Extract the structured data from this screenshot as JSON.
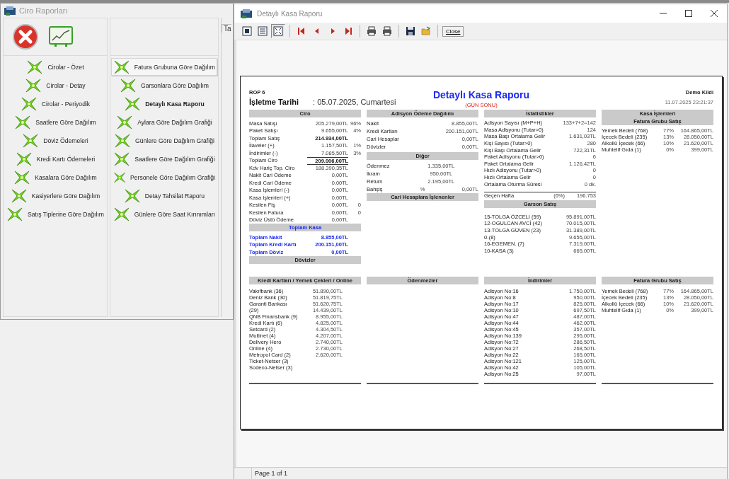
{
  "left_window": {
    "title": "Ciro Raporları",
    "hidden_tab": "Ta",
    "column_1": [
      {
        "label": "Cirolar - Özet",
        "selected": false,
        "hovered": false
      },
      {
        "label": "Cirolar - Detay",
        "selected": false,
        "hovered": false
      },
      {
        "label": "Cirolar - Periyodik",
        "selected": false,
        "hovered": false
      },
      {
        "label": "Saatlere Göre Dağılım",
        "selected": false,
        "hovered": false
      },
      {
        "label": "Döviz Ödemeleri",
        "selected": false,
        "hovered": false
      },
      {
        "label": "Kredi Kartı Ödemeleri",
        "selected": false,
        "hovered": false
      },
      {
        "label": "Kasalara Göre Dağılım",
        "selected": false,
        "hovered": false
      },
      {
        "label": "Kasiyerlere Göre Dağılım",
        "selected": false,
        "hovered": false
      },
      {
        "label": "Satış Tiplerine Göre Dağılım",
        "selected": false,
        "hovered": false
      }
    ],
    "column_2": [
      {
        "label": "Fatura Grubuna Göre Dağılım",
        "selected": false,
        "hovered": true
      },
      {
        "label": "Garsonlara Göre Dağılım",
        "selected": false,
        "hovered": false
      },
      {
        "label": "Detaylı Kasa Raporu",
        "selected": true,
        "hovered": false
      },
      {
        "label": "Aylara Göre Dağılım Grafiği",
        "selected": false,
        "hovered": false
      },
      {
        "label": "Günlere Göre Dağılım Grafiği",
        "selected": false,
        "hovered": false
      },
      {
        "label": "Saatlere Göre Dağılım Grafiği",
        "selected": false,
        "hovered": false
      },
      {
        "label": "Personele Göre Dağılım Grafiği",
        "selected": false,
        "hovered": false
      },
      {
        "label": "Detay Tahsilat Raporu",
        "selected": false,
        "hovered": false
      },
      {
        "label": "Günlere Göre Saat Kırınımları",
        "selected": false,
        "hovered": false
      }
    ]
  },
  "report_window": {
    "title": "Detaylı Kasa Raporu",
    "view_modes": [
      {
        "selected": false
      },
      {
        "selected": false
      },
      {
        "selected": true
      }
    ],
    "close_button": "Close",
    "status": "Page 1 of 1",
    "report": {
      "code": "ROP 6",
      "date_label": "İşletme Tarihi",
      "date_value": ": 05.07.2025, Cumartesi",
      "title": "Detaylı Kasa Raporu",
      "subtitle": "(GÜN SONU)",
      "company": "Demo Kildi",
      "printed_at": "11.07.2025 23:21:37",
      "top_columns": [
        [
          {
            "title": "Ciro",
            "kind": "ciro",
            "rows": [
              {
                "kind": "plain",
                "cells": [
                  "Masa Satışı",
                  "205.279,00TL",
                  "96%"
                ]
              },
              {
                "kind": "plain",
                "cells": [
                  "Paket Satışı",
                  "9.655,00TL",
                  "4%"
                ]
              },
              {
                "kind": "bold",
                "cells": [
                  "Toplam Satış",
                  "214.934,00TL"
                ]
              },
              {
                "kind": "plain",
                "cells": [
                  "İlaveler (+)",
                  "1.157,50TL",
                  "1%"
                ]
              },
              {
                "kind": "plain",
                "cells": [
                  "İndirimler (-)",
                  "7.085,50TL",
                  "3%"
                ]
              },
              {
                "kind": "ruled-bold",
                "cells": [
                  "Toplam Ciro",
                  "209.006,00TL"
                ]
              },
              {
                "kind": "ruled",
                "cells": [
                  "Kdv Hariç Top. Ciro",
                  "188.390,35TL"
                ]
              },
              {
                "kind": "plain",
                "cells": [
                  "Nakit Cari Ödeme",
                  "0,00TL"
                ]
              },
              {
                "kind": "plain",
                "cells": [
                  "Kredi Cari Ödeme",
                  "0,00TL"
                ]
              },
              {
                "kind": "plain",
                "cells": [
                  "Kasa İşlemleri (-)",
                  "0,00TL"
                ]
              },
              {
                "kind": "plain",
                "cells": [
                  "Kasa İşlemleri (+)",
                  "0,00TL"
                ]
              },
              {
                "kind": "plain",
                "cells": [
                  "Kesilen Fiş",
                  "0,00TL",
                  "0"
                ]
              },
              {
                "kind": "plain",
                "cells": [
                  "Kesilen Fatura",
                  "0,00TL",
                  "0"
                ]
              },
              {
                "kind": "plain",
                "cells": [
                  "Döviz Üstü Ödeme",
                  "0,00TL"
                ]
              }
            ]
          },
          {
            "title": "Toplam Kasa",
            "kind": "totals",
            "rows": [
              {
                "kind": "bold",
                "cells": [
                  "Toplam Nakit",
                  "8.855,00TL"
                ]
              },
              {
                "kind": "bold",
                "cells": [
                  "Toplam Kredi Kartı",
                  "200.151,00TL"
                ]
              },
              {
                "kind": "bold",
                "cells": [
                  "Toplam Döviz",
                  "0,00TL"
                ]
              }
            ]
          },
          {
            "title": "Dövizler",
            "kind": "empty"
          }
        ],
        [
          {
            "title": "Adisyon Ödeme Dağılımı",
            "kind": "payment",
            "rows": [
              {
                "kind": "plain",
                "cells": [
                  "Nakit",
                  "8.855,00TL"
                ]
              },
              {
                "kind": "plain",
                "cells": [
                  "Kredi Kartları",
                  "200.151,00TL"
                ]
              },
              {
                "kind": "plain",
                "cells": [
                  "Cari Hesaplar",
                  "0,00TL"
                ]
              },
              {
                "kind": "plain",
                "cells": [
                  "Dövizler",
                  "0,00TL"
                ]
              }
            ]
          },
          {
            "title": "Diğer",
            "kind": "other",
            "rows": [
              {
                "kind": "plain",
                "cells": [
                  "Ödenmez",
                  "1.335,00TL"
                ]
              },
              {
                "kind": "plain",
                "cells": [
                  "İkram",
                  "950,00TL"
                ]
              },
              {
                "kind": "plain",
                "cells": [
                  "Return",
                  "2.195,00TL"
                ]
              },
              {
                "kind": "plain",
                "cells": [
                  "Bahşiş",
                  "%",
                  "0,00TL"
                ]
              }
            ]
          },
          {
            "title": "Cari Hesaplara İşlenenler",
            "kind": "empty"
          }
        ],
        [
          {
            "title": "İstatistikler",
            "kind": "stats",
            "rows": [
              {
                "kind": "plain",
                "cells": [
                  "Adisyon Sayısı (M+P+H)",
                  "133+7+2=142"
                ]
              },
              {
                "kind": "plain",
                "cells": [
                  "Masa Adisyonu (Tutar>0)",
                  "124"
                ]
              },
              {
                "kind": "plain",
                "cells": [
                  "Masa Başı Ortalama Gelir",
                  "1.631,03TL"
                ]
              },
              {
                "kind": "plain",
                "cells": [
                  "Kişi Sayısı (Tutar>0)",
                  "280"
                ]
              },
              {
                "kind": "plain",
                "cells": [
                  "Kişi Başı Ortalama Gelir",
                  "722,31TL"
                ]
              },
              {
                "kind": "plain",
                "cells": [
                  "Paket Adisyonu (Tutar>0)",
                  "6"
                ]
              },
              {
                "kind": "plain",
                "cells": [
                  "Paket Ortalama Gelir",
                  "1.126,42TL"
                ]
              },
              {
                "kind": "plain",
                "cells": [
                  "Hızlı Adisyonu (Tutar>0)",
                  "0"
                ]
              },
              {
                "kind": "plain",
                "cells": [
                  "Hızlı Ortalama Gelir",
                  "0"
                ]
              },
              {
                "kind": "plain",
                "cells": [
                  "Ortalama Oturma Süresi",
                  "0 dk."
                ]
              },
              {
                "kind": "ruled",
                "cells": [
                  "Geçen Hafta",
                  "(6%)",
                  "196.753"
                ]
              }
            ]
          },
          {
            "title": "Garson Satış",
            "kind": "waiter",
            "rows": [
              {
                "kind": "plain",
                "cells": [
                  "15-TOLGA ÖZCELİ (59)",
                  "95.891,00TL"
                ]
              },
              {
                "kind": "plain",
                "cells": [
                  "12-OGULCAN AVCİ (42)",
                  "70.015,00TL"
                ]
              },
              {
                "kind": "plain",
                "cells": [
                  "13-TOLGA GÜVEN (23)",
                  "31.389,00TL"
                ]
              },
              {
                "kind": "plain",
                "cells": [
                  "0-(8)",
                  "9.655,00TL"
                ]
              },
              {
                "kind": "plain",
                "cells": [
                  "16-EGEMEN. (7)",
                  "7.319,00TL"
                ]
              },
              {
                "kind": "plain",
                "cells": [
                  "10-KASA (3)",
                  "665,00TL"
                ]
              }
            ]
          }
        ],
        [
          {
            "title": "Kasa İşlemleri",
            "kind": "empty"
          },
          {
            "title": "Fatura Grubu Satış",
            "kind": "group",
            "rows": [
              {
                "kind": "plain",
                "cells": [
                  "Yemek Bedeli (768)",
                  "77%",
                  "164.865,00TL"
                ]
              },
              {
                "kind": "plain",
                "cells": [
                  "İçecek Bedeli (235)",
                  "13%",
                  "28.050,00TL"
                ]
              },
              {
                "kind": "plain",
                "cells": [
                  "Alkollü İçecek (66)",
                  "10%",
                  "21.620,00TL"
                ]
              },
              {
                "kind": "plain",
                "cells": [
                  "Muhtelif Gıda (1)",
                  "0%",
                  "399,00TL"
                ]
              }
            ]
          }
        ]
      ],
      "bottom_sections": [
        {
          "title": "Kredi Kartları / Yemek Çekleri / Online",
          "kind": "cards",
          "rows": [
            {
              "kind": "plain",
              "cells": [
                "Vakıfbank (36)",
                "51.890,00TL"
              ]
            },
            {
              "kind": "plain",
              "cells": [
                "Deniz Bank (30)",
                "51.819,75TL"
              ]
            },
            {
              "kind": "plain",
              "cells": [
                "Garanti Bankası",
                "51.620,75TL"
              ]
            },
            {
              "kind": "plain",
              "cells": [
                "(29)",
                "14.439,00TL"
              ]
            },
            {
              "kind": "plain",
              "cells": [
                "QNB Finansbank (9)",
                "8.955,00TL"
              ]
            },
            {
              "kind": "plain",
              "cells": [
                "Kredi Kartı (6)",
                "4.825,00TL"
              ]
            },
            {
              "kind": "plain",
              "cells": [
                "Setcard (2)",
                "4.304,50TL"
              ]
            },
            {
              "kind": "plain",
              "cells": [
                "Multinet (4)",
                "4.207,00TL"
              ]
            },
            {
              "kind": "plain",
              "cells": [
                "Delivery Hero",
                "2.740,00TL"
              ]
            },
            {
              "kind": "plain",
              "cells": [
                "Online (4)",
                "2.730,00TL"
              ]
            },
            {
              "kind": "plain",
              "cells": [
                "Metropol Card (2)",
                "2.620,00TL"
              ]
            },
            {
              "kind": "plain",
              "cells": [
                "Ticket-Netser (3)"
              ]
            },
            {
              "kind": "plain",
              "cells": [
                "Sodexo-Netser (3)"
              ]
            }
          ]
        },
        {
          "title": "Ödenmezler",
          "kind": "empty"
        },
        {
          "title": "İndirimler",
          "kind": "discounts",
          "rows": [
            {
              "kind": "plain",
              "cells": [
                "Adisyon No:16",
                "1.750,00TL"
              ]
            },
            {
              "kind": "plain",
              "cells": [
                "Adisyon No:8",
                "950,00TL"
              ]
            },
            {
              "kind": "plain",
              "cells": [
                "Adisyon No:17",
                "825,00TL"
              ]
            },
            {
              "kind": "plain",
              "cells": [
                "Adisyon No:10",
                "697,50TL"
              ]
            },
            {
              "kind": "plain",
              "cells": [
                "Adisyon No:47",
                "487,00TL"
              ]
            },
            {
              "kind": "plain",
              "cells": [
                "Adisyon No:44",
                "462,00TL"
              ]
            },
            {
              "kind": "plain",
              "cells": [
                "Adisyon No:45",
                "357,00TL"
              ]
            },
            {
              "kind": "plain",
              "cells": [
                "Adisyon No:139",
                "295,00TL"
              ]
            },
            {
              "kind": "plain",
              "cells": [
                "Adisyon No:72",
                "286,50TL"
              ]
            },
            {
              "kind": "plain",
              "cells": [
                "Adisyon No:27",
                "268,50TL"
              ]
            },
            {
              "kind": "plain",
              "cells": [
                "Adisyon No:22",
                "165,00TL"
              ]
            },
            {
              "kind": "plain",
              "cells": [
                "Adisyon No:121",
                "125,00TL"
              ]
            },
            {
              "kind": "plain",
              "cells": [
                "Adisyon No:42",
                "105,00TL"
              ]
            },
            {
              "kind": "plain",
              "cells": [
                "Adisyon No:25",
                "97,00TL"
              ]
            }
          ]
        },
        {
          "title": "Fatura Grubu Satış",
          "kind": "group",
          "rows": [
            {
              "kind": "plain",
              "cells": [
                "Yemek Bedeli (768)",
                "77%",
                "164.865,00TL"
              ]
            },
            {
              "kind": "plain",
              "cells": [
                "İçecek Bedeli (235)",
                "13%",
                "28.050,00TL"
              ]
            },
            {
              "kind": "plain",
              "cells": [
                "Alkollü İçecek (66)",
                "10%",
                "21.620,00TL"
              ]
            },
            {
              "kind": "plain",
              "cells": [
                "Muhtelif Gıda (1)",
                "0%",
                "399,00TL"
              ]
            }
          ]
        }
      ]
    }
  }
}
